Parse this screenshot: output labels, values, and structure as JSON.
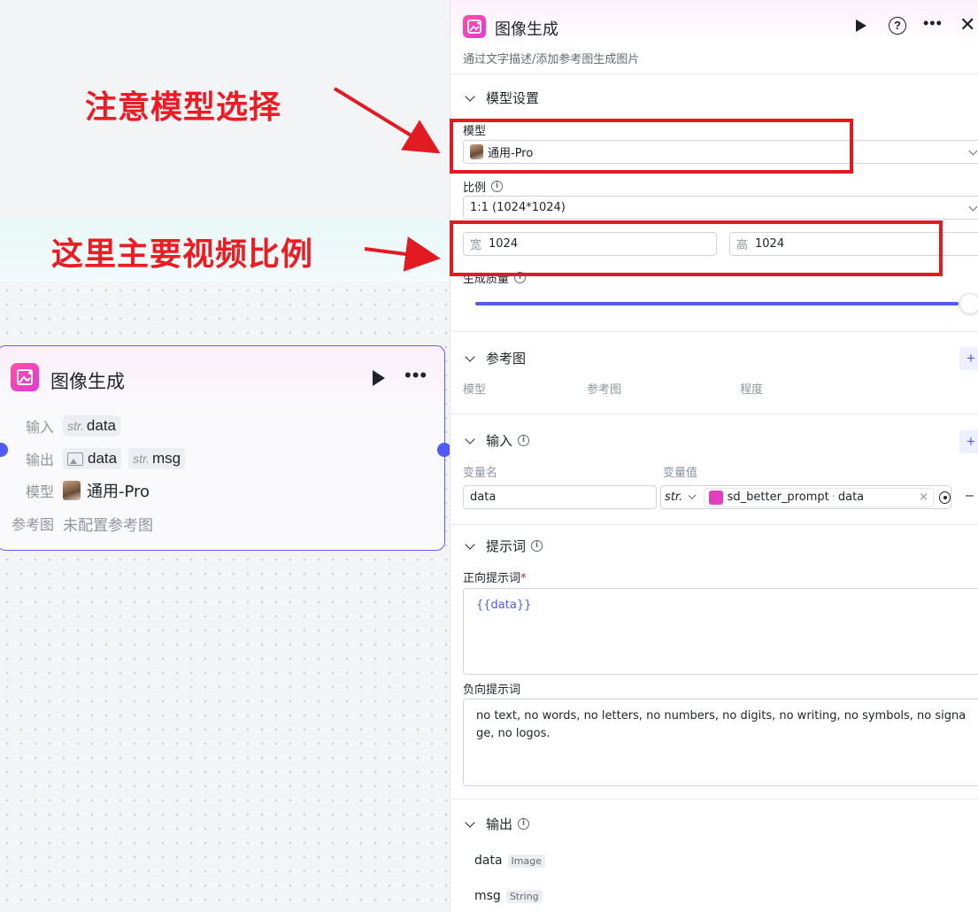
{
  "annotations": {
    "note_model": "注意模型选择",
    "note_ratio": "这里主要视频比例"
  },
  "node": {
    "title": "图像生成",
    "input_label": "输入",
    "input_type": "str.",
    "input_value": "data",
    "output_label": "输出",
    "output_value_1": "data",
    "output_type_2": "str.",
    "output_value_2": "msg",
    "model_label": "模型",
    "model_value": "通用-Pro",
    "ref_label": "参考图",
    "ref_value": "未配置参考图"
  },
  "panel": {
    "title": "图像生成",
    "subtitle": "通过文字描述/添加参考图生成图片",
    "model_settings": {
      "section_title": "模型设置",
      "model_label": "模型",
      "model_value": "通用-Pro",
      "ratio_label": "比例",
      "ratio_value": "1:1 (1024*1024)",
      "width_label": "宽",
      "width_value": "1024",
      "height_label": "高",
      "height_value": "1024",
      "quality_label": "生成质量",
      "quality_level": 1.0
    },
    "reference": {
      "section_title": "参考图",
      "add_label": "+",
      "columns": [
        "模型",
        "参考图",
        "程度"
      ]
    },
    "input": {
      "section_title": "输入",
      "add_label": "+",
      "col_name": "变量名",
      "col_value": "变量值",
      "var_name": "data",
      "var_type": "str.",
      "ref_source": "sd_better_prompt",
      "ref_sep": "·",
      "ref_var": "data",
      "clear": "×",
      "remove": "–"
    },
    "prompt": {
      "section_title": "提示词",
      "positive_label": "正向提示词",
      "required_mark": "*",
      "positive_value": "{{data}}",
      "negative_label": "负向提示词",
      "negative_value": "no text, no words, no letters, no numbers, no digits, no writing, no symbols, no signage, no logos."
    },
    "output": {
      "section_title": "输出",
      "items": [
        {
          "name": "data",
          "type": "Image"
        },
        {
          "name": "msg",
          "type": "String"
        }
      ]
    }
  },
  "colors": {
    "accent": "#4e5bf5",
    "annotation": "#e21b23",
    "node_border": "#6b5cf0"
  }
}
